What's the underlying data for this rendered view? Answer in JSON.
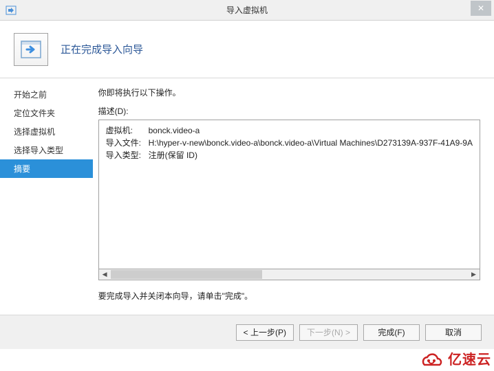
{
  "window": {
    "title": "导入虚拟机",
    "close_glyph": "✕"
  },
  "header": {
    "title": "正在完成导入向导"
  },
  "sidebar": {
    "items": [
      {
        "label": "开始之前"
      },
      {
        "label": "定位文件夹"
      },
      {
        "label": "选择虚拟机"
      },
      {
        "label": "选择导入类型"
      },
      {
        "label": "摘要"
      }
    ],
    "selected_index": 4
  },
  "main": {
    "intro": "你即将执行以下操作。",
    "desc_label": "描述(D):",
    "rows": [
      {
        "key": "虚拟机:",
        "val": "bonck.video-a"
      },
      {
        "key": "导入文件:",
        "val": "H:\\hyper-v-new\\bonck.video-a\\bonck.video-a\\Virtual Machines\\D273139A-937F-41A9-9A"
      },
      {
        "key": "导入类型:",
        "val": "注册(保留 ID)"
      }
    ],
    "instruction": "要完成导入并关闭本向导，请单击\"完成\"。"
  },
  "buttons": {
    "prev": "< 上一步(P)",
    "next": "下一步(N) >",
    "finish": "完成(F)",
    "cancel": "取消"
  },
  "watermark": {
    "text": "亿速云"
  },
  "scroll": {
    "left": "◀",
    "right": "▶"
  }
}
